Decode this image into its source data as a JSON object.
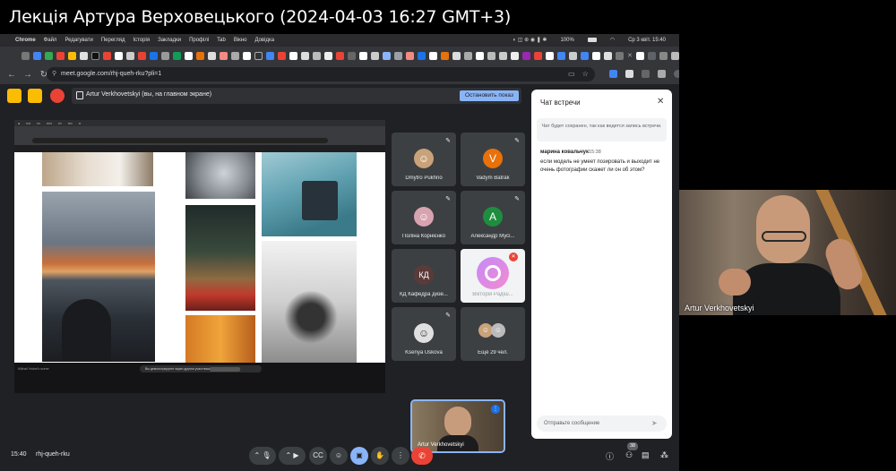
{
  "recording_title": "Лекція Артура Верховецького (2024-04-03 16:27 GMT+3)",
  "mac_menu": {
    "app": "Chrome",
    "items": [
      "Файл",
      "Редагувати",
      "Перегляд",
      "Історія",
      "Закладки",
      "Профілі",
      "Tab",
      "Вікно",
      "Довідка"
    ],
    "battery": "100%",
    "clock": "Ср 3 квіт.  15:40"
  },
  "browser": {
    "url": "meet.google.com/rhj-queh-rku?pli=1"
  },
  "meet": {
    "presenting_text": "Artur Verkhovetskyi (вы, на главном экране)",
    "stop_presenting_label": "Остановить показ",
    "shared_bottom_pill": "Вы демонстрируете экран другим участникам",
    "shared_bottom_tag": "Mikhail Vrubel's scene"
  },
  "participants": [
    {
      "name": "Dmytro Pukhno",
      "initial": "",
      "color": "#c9a27a",
      "muted": true
    },
    {
      "name": "Vadym Batrak",
      "initial": "V",
      "color": "#e8710a",
      "muted": true
    },
    {
      "name": "Поліна Корнієнко",
      "initial": "",
      "color": "#d8a3b0",
      "muted": true
    },
    {
      "name": "Александр Мусі...",
      "initial": "А",
      "color": "#1e8e3e",
      "muted": true
    },
    {
      "name": "КД Кафедра дизе...",
      "initial": "КД",
      "color": "#5b3a3a",
      "muted": false
    },
    {
      "name": "Вікторія Радіш...",
      "initial": "",
      "color": "#ffffff",
      "muted": true
    },
    {
      "name": "Ksenya Uskova",
      "initial": "",
      "color": "#e0e0e0",
      "muted": true
    },
    {
      "name": "Ещё 29 чел.",
      "initial": "",
      "color": "#3c4043",
      "muted": false
    }
  ],
  "self_tile_name": "Artur Verkhovetskyi",
  "chat": {
    "title": "Чат встречи",
    "note": "Чат будет сохранен, так как ведется запись встречи.",
    "message": {
      "author": "марина ковальчук",
      "time": "15:38",
      "text": "если модель не умеет позировать и выходит не очень фотографии скажет ли он об этом?"
    },
    "input_placeholder": "Отправьте сообщение"
  },
  "bottom": {
    "time": "15:40",
    "meeting_code": "rhj-queh-rku",
    "participants_badge": "38"
  },
  "speaker": {
    "name": "Artur Verkhovetskyi"
  }
}
